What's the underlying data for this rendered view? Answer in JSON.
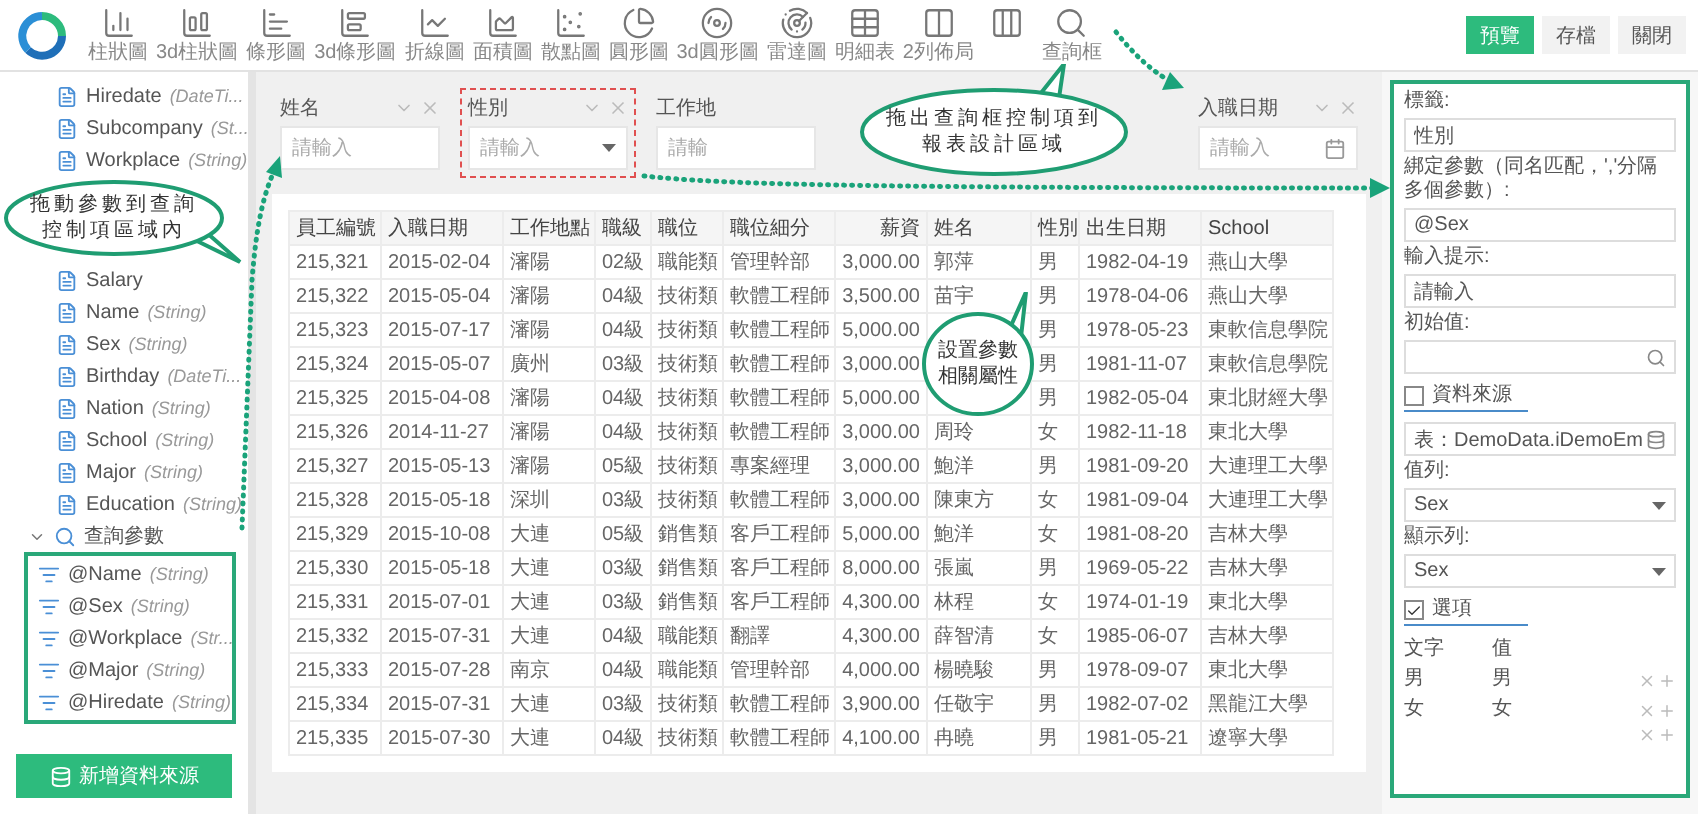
{
  "toolbar": {
    "items": [
      {
        "kind": "bar",
        "label": "柱狀圖"
      },
      {
        "kind": "bar3d",
        "label": "3d柱狀圖"
      },
      {
        "kind": "hbar",
        "label": "條形圖"
      },
      {
        "kind": "hbar3d",
        "label": "3d條形圖"
      },
      {
        "kind": "line",
        "label": "折線圖"
      },
      {
        "kind": "area",
        "label": "面積圖"
      },
      {
        "kind": "scatter",
        "label": "散點圖"
      },
      {
        "kind": "pie",
        "label": "圓形圖"
      },
      {
        "kind": "pie3d",
        "label": "3d圓形圖"
      },
      {
        "kind": "radar",
        "label": "雷達圖"
      },
      {
        "kind": "table",
        "label": "明細表"
      },
      {
        "kind": "cols2",
        "label": "2列佈局"
      },
      {
        "kind": "cols3"
      },
      {
        "kind": "search",
        "label": "查詢框"
      }
    ],
    "actions": [
      {
        "label": "預覽",
        "primary": true
      },
      {
        "label": "存檔",
        "primary": false
      },
      {
        "label": "關閉",
        "primary": false
      }
    ]
  },
  "sidebar": {
    "fields": [
      {
        "name": "Hiredate",
        "type": "(DateTi..."
      },
      {
        "name": "Subcompany",
        "type": "(St..."
      },
      {
        "name": "Workplace",
        "type": "(String)"
      }
    ],
    "callout": "拖動參數到查詢控制項區域內",
    "more_fields": [
      {
        "name": "Salary"
      },
      {
        "name": "Name",
        "type": "(String)"
      },
      {
        "name": "Sex",
        "type": "(String)"
      },
      {
        "name": "Birthday",
        "type": "(DateTi..."
      },
      {
        "name": "Nation",
        "type": "(String)"
      },
      {
        "name": "School",
        "type": "(String)"
      },
      {
        "name": "Major",
        "type": "(String)"
      },
      {
        "name": "Education",
        "type": "(String)"
      }
    ],
    "param_group": {
      "label": "查詢參數",
      "expanded": true,
      "children": [
        {
          "name": "@Name",
          "type": "(String)"
        },
        {
          "name": "@Sex",
          "type": "(String)"
        },
        {
          "name": "@Workplace",
          "type": "(Str..."
        },
        {
          "name": "@Major",
          "type": "(String)"
        },
        {
          "name": "@Hiredate",
          "type": "(String)"
        }
      ]
    },
    "add_button": "新增資料來源"
  },
  "filters": {
    "callout": "拖出查詢框控制項到報表設計區域",
    "items": [
      {
        "label": "姓名",
        "placeholder": "請輸入",
        "kind": "text",
        "clearable": true,
        "selected": false
      },
      {
        "label": "性別",
        "placeholder": "請輸入",
        "kind": "select",
        "clearable": true,
        "selected": true
      },
      {
        "label": "工作地",
        "placeholder": "請輸",
        "kind": "text",
        "clearable": false,
        "selected": false
      },
      {
        "label": "入職日期",
        "placeholder": "請輸入",
        "kind": "date",
        "clearable": true,
        "selected": false
      }
    ]
  },
  "table": {
    "callout": "設置參數相關屬性",
    "columns": [
      "員工編號",
      "入職日期",
      "工作地點",
      "職級",
      "職位",
      "職位細分",
      "薪資",
      "姓名",
      "性別",
      "出生日期",
      "School"
    ],
    "rows": [
      [
        "215,321",
        "2015-02-04",
        "瀋陽",
        "02級",
        "職能類",
        "管理幹部",
        "3,000.00",
        "郭萍",
        "男",
        "1982-04-19",
        "燕山大學"
      ],
      [
        "215,322",
        "2015-05-04",
        "瀋陽",
        "04級",
        "技術類",
        "軟體工程師",
        "3,500.00",
        "苗宇",
        "男",
        "1978-04-06",
        "燕山大學"
      ],
      [
        "215,323",
        "2015-07-17",
        "瀋陽",
        "04級",
        "技術類",
        "軟體工程師",
        "5,000.00",
        null,
        "男",
        "1978-05-23",
        "東軟信息學院"
      ],
      [
        "215,324",
        "2015-05-07",
        "廣州",
        "03級",
        "技術類",
        "軟體工程師",
        "3,000.00",
        null,
        "男",
        "1981-11-07",
        "東軟信息學院"
      ],
      [
        "215,325",
        "2015-04-08",
        "瀋陽",
        "04級",
        "技術類",
        "軟體工程師",
        "5,000.00",
        null,
        "男",
        "1982-05-04",
        "東北財經大學"
      ],
      [
        "215,326",
        "2014-11-27",
        "瀋陽",
        "04級",
        "技術類",
        "軟體工程師",
        "3,000.00",
        "周玲",
        "女",
        "1982-11-18",
        "東北大學"
      ],
      [
        "215,327",
        "2015-05-13",
        "瀋陽",
        "05級",
        "技術類",
        "專案經理",
        "3,000.00",
        "鮑洋",
        "男",
        "1981-09-20",
        "大連理工大學"
      ],
      [
        "215,328",
        "2015-05-18",
        "深圳",
        "03級",
        "技術類",
        "軟體工程師",
        "3,000.00",
        "陳東方",
        "女",
        "1981-09-04",
        "大連理工大學"
      ],
      [
        "215,329",
        "2015-10-08",
        "大連",
        "05級",
        "銷售類",
        "客戶工程師",
        "5,000.00",
        "鮑洋",
        "女",
        "1981-08-20",
        "吉林大學"
      ],
      [
        "215,330",
        "2015-05-18",
        "大連",
        "03級",
        "銷售類",
        "客戶工程師",
        "8,000.00",
        "張嵐",
        "男",
        "1969-05-22",
        "吉林大學"
      ],
      [
        "215,331",
        "2015-07-01",
        "大連",
        "03級",
        "銷售類",
        "客戶工程師",
        "4,300.00",
        "林程",
        "女",
        "1974-01-19",
        "東北大學"
      ],
      [
        "215,332",
        "2015-07-31",
        "大連",
        "04級",
        "職能類",
        "翻譯",
        "4,300.00",
        "薛智清",
        "女",
        "1985-06-07",
        "吉林大學"
      ],
      [
        "215,333",
        "2015-07-28",
        "南京",
        "04級",
        "職能類",
        "管理幹部",
        "4,000.00",
        "楊曉駿",
        "男",
        "1978-09-07",
        "東北大學"
      ],
      [
        "215,334",
        "2015-07-31",
        "大連",
        "03級",
        "技術類",
        "軟體工程師",
        "3,900.00",
        "任敬宇",
        "男",
        "1982-07-02",
        "黑龍江大學"
      ],
      [
        "215,335",
        "2015-07-30",
        "大連",
        "04級",
        "技術類",
        "軟體工程師",
        "4,100.00",
        "冉曉",
        "男",
        "1981-05-21",
        "遼寧大學"
      ]
    ]
  },
  "properties": {
    "fields": [
      {
        "label": "標籤:",
        "value": "性別"
      },
      {
        "label": "綁定參數（同名匹配，','分隔多個參數）:",
        "value": "@Sex"
      },
      {
        "label": "輸入提示:",
        "value": "請輸入"
      },
      {
        "label": "初始值:",
        "kind": "search"
      }
    ],
    "datasource": {
      "label": "資料來源",
      "checked": false,
      "table": "表：DemoData.iDemoEm"
    },
    "selects": [
      {
        "label": "值列:",
        "value": "Sex"
      },
      {
        "label": "顯示列:",
        "value": "Sex"
      }
    ],
    "options": {
      "label": "選項",
      "checked": true,
      "columns": [
        "文字",
        "值"
      ],
      "rows": [
        [
          "男",
          "男"
        ],
        [
          "女",
          "女"
        ]
      ],
      "blank_row": true
    }
  }
}
